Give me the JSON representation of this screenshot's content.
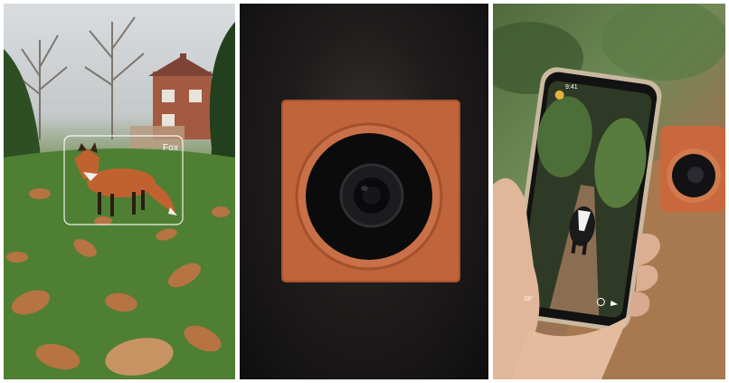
{
  "panels": [
    {
      "id": "fox-scene",
      "detection_label": "Fox"
    },
    {
      "id": "camera-product"
    },
    {
      "id": "phone-app",
      "status_time": "9:41",
      "temperature": "18°"
    }
  ],
  "colors": {
    "camera_orange": "#c0643c",
    "detection_box": "#ffffff",
    "grass": "#4f7f33"
  }
}
